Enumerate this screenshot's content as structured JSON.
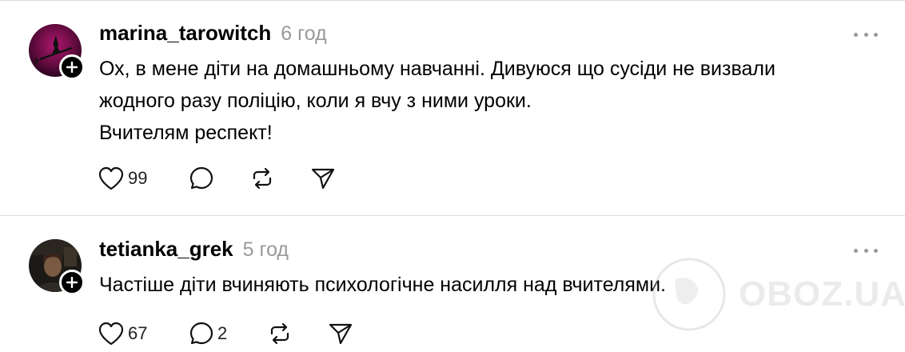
{
  "posts": [
    {
      "username": "marina_tarowitch",
      "time": "6 год",
      "lines": [
        "Ох, в мене діти на домашньому навчанні. Дивуюся що сусіди не визвали",
        "жодного разу поліцію, коли я вчу з ними уроки.",
        "Вчителям респект!"
      ],
      "likes": "99",
      "replies": "",
      "avatar_icon": "witch-on-broom-icon"
    },
    {
      "username": "tetianka_grek",
      "time": "5 год",
      "lines": [
        "Частіше діти вчиняють психологічне насилля над вчителями."
      ],
      "likes": "67",
      "replies": "2",
      "avatar_icon": "person-photo-icon"
    }
  ],
  "watermark": {
    "text": "OBOZ.UA"
  },
  "colors": {
    "text": "#000000",
    "secondary": "#999999",
    "divider": "#dedede"
  }
}
